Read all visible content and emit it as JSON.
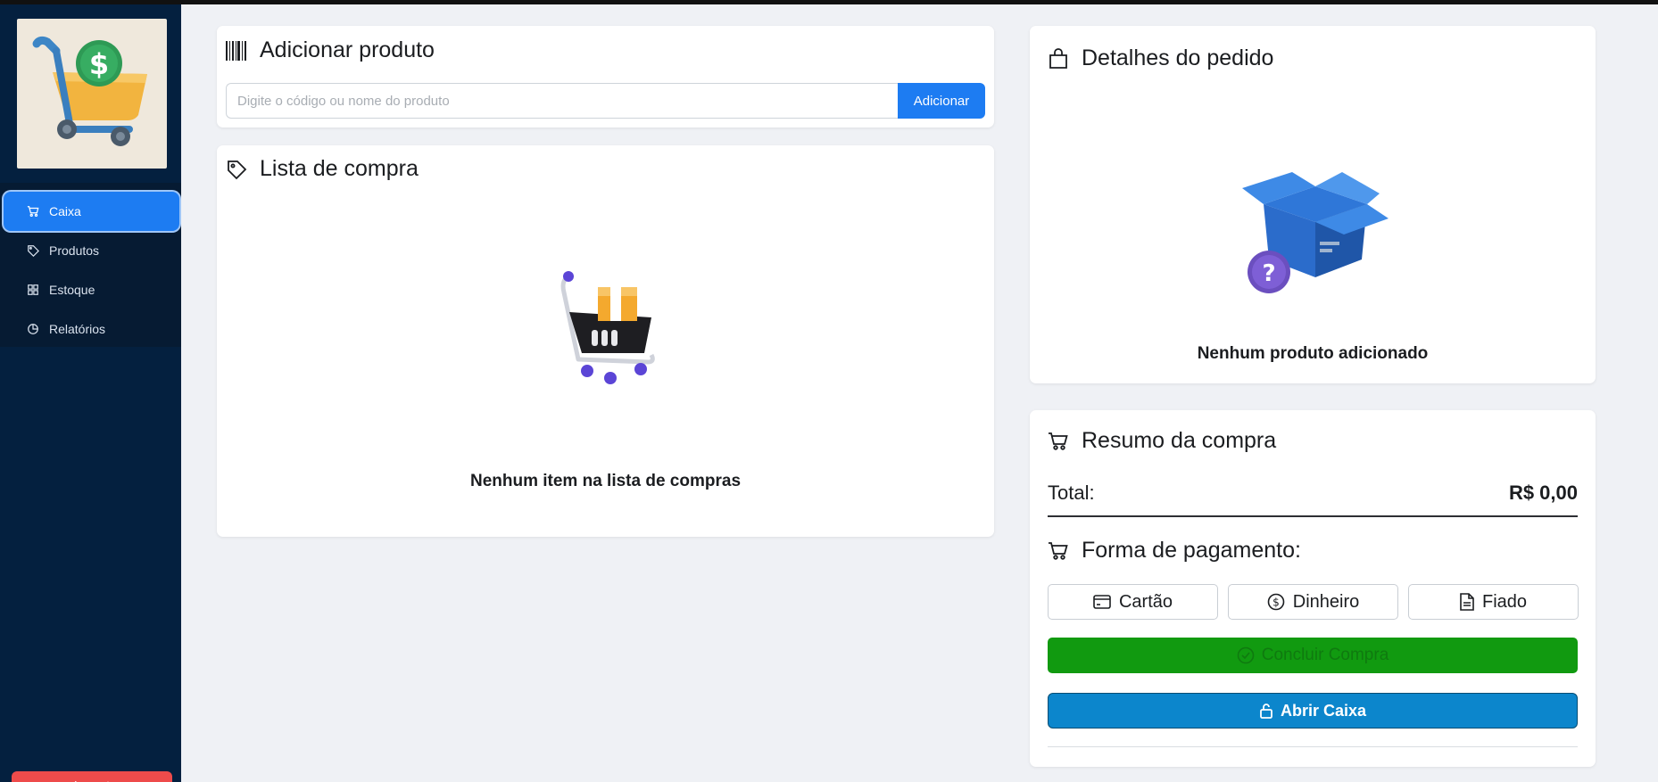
{
  "sidebar": {
    "items": [
      {
        "label": "Caixa",
        "icon": "cart-icon",
        "active": true
      },
      {
        "label": "Produtos",
        "icon": "tag-icon"
      },
      {
        "label": "Estoque",
        "icon": "grid-icon"
      },
      {
        "label": "Relatórios",
        "icon": "pie-chart-icon"
      }
    ],
    "logout_label": "Logout"
  },
  "add_product": {
    "title": "Adicionar produto",
    "search_placeholder": "Digite o código ou nome do produto",
    "add_label": "Adicionar"
  },
  "shopping_list": {
    "title": "Lista de compra",
    "empty_text": "Nenhum item na lista de compras"
  },
  "order_details": {
    "title": "Detalhes do pedido",
    "empty_text": "Nenhum produto adicionado"
  },
  "summary": {
    "title": "Resumo da compra",
    "total_label": "Total:",
    "total_value": "R$ 0,00",
    "payment_title": "Forma de pagamento:",
    "payment_methods": [
      {
        "label": "Cartão",
        "icon": "credit-card-icon"
      },
      {
        "label": "Dinheiro",
        "icon": "dollar-circle-icon"
      },
      {
        "label": "Fiado",
        "icon": "document-icon"
      }
    ],
    "finish_label": "Concluir Compra",
    "open_register_label": "Abrir Caixa"
  },
  "colors": {
    "sidebar_bg": "#04203f",
    "primary": "#1d7cf2",
    "success": "#119a10",
    "info": "#0c86cc",
    "danger": "#ee4b4b",
    "page_bg": "#eff1f5"
  }
}
